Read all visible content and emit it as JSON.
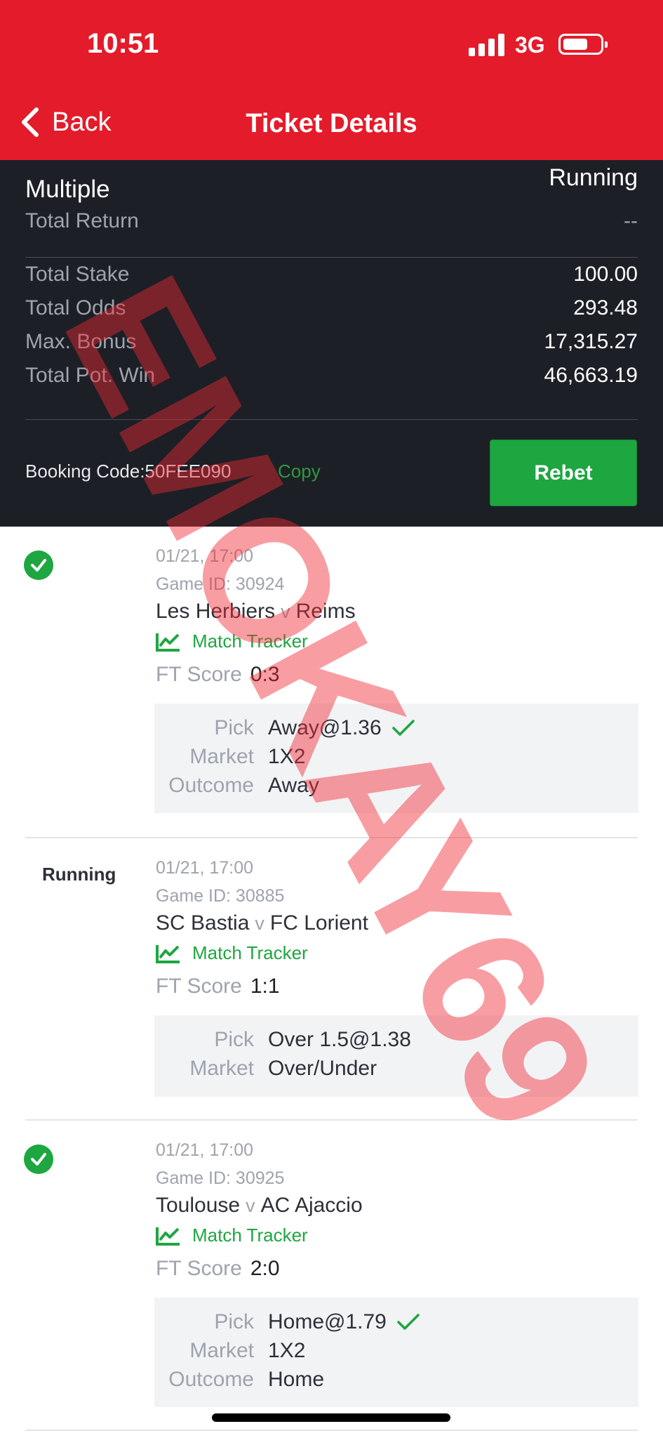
{
  "status_bar": {
    "time": "10:51",
    "network": "3G"
  },
  "nav": {
    "back_label": "Back",
    "title": "Ticket Details"
  },
  "summary": {
    "bet_type": "Multiple",
    "status": "Running",
    "total_return_label": "Total Return",
    "total_return_value": "--",
    "rows": [
      {
        "label": "Total Stake",
        "value": "100.00"
      },
      {
        "label": "Total Odds",
        "value": "293.48"
      },
      {
        "label": "Max. Bonus",
        "value": "17,315.27"
      },
      {
        "label": "Total Pot. Win",
        "value": "46,663.19"
      }
    ],
    "booking_code": "Booking Code:50FEE090",
    "copy_label": "Copy",
    "rebet_label": "Rebet"
  },
  "selections": [
    {
      "status": "won",
      "date": "01/21, 17:00",
      "game_id": "Game ID: 30924",
      "home": "Les Herbiers",
      "vs": "v",
      "away": "Reims",
      "tracker_label": "Match Tracker",
      "ft_label": "FT Score",
      "ft_score": "0:3",
      "pick_label": "Pick",
      "pick": "Away@1.36",
      "market_label": "Market",
      "market": "1X2",
      "outcome_label": "Outcome",
      "outcome": "Away"
    },
    {
      "status": "Running",
      "date": "01/21, 17:00",
      "game_id": "Game ID: 30885",
      "home": "SC Bastia",
      "vs": "v",
      "away": "FC Lorient",
      "tracker_label": "Match Tracker",
      "ft_label": "FT Score",
      "ft_score": "1:1",
      "pick_label": "Pick",
      "pick": "Over 1.5@1.38",
      "market_label": "Market",
      "market": "Over/Under"
    },
    {
      "status": "won",
      "date": "01/21, 17:00",
      "game_id": "Game ID: 30925",
      "home": "Toulouse",
      "vs": "v",
      "away": "AC Ajaccio",
      "tracker_label": "Match Tracker",
      "ft_label": "FT Score",
      "ft_score": "2:0",
      "pick_label": "Pick",
      "pick": "Home@1.79",
      "market_label": "Market",
      "market": "1X2",
      "outcome_label": "Outcome",
      "outcome": "Home"
    }
  ],
  "watermark": "EMOKAY69",
  "colors": {
    "brand_red": "#e41b2a",
    "dark_bg": "#1c1f26",
    "success_green": "#1ea640"
  }
}
